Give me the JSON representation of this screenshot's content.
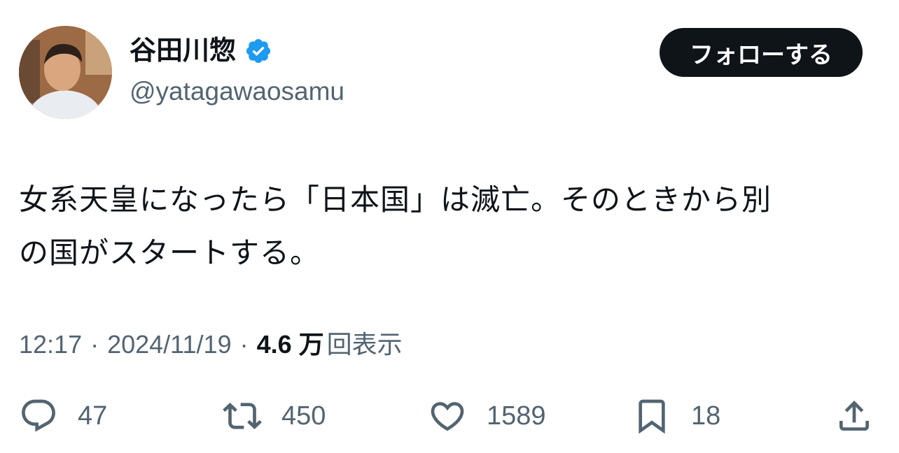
{
  "author": {
    "display_name": "谷田川惣",
    "handle": "@yatagawaosamu",
    "verified": true,
    "verified_color": "#1d9bf0"
  },
  "follow_button": {
    "label": "フォローする"
  },
  "tweet": {
    "line1": "女系天皇になったら「日本国」は滅亡。そのときから別",
    "line2": "の国がスタートする。"
  },
  "meta": {
    "time": "12:17",
    "separator": "·",
    "date": "2024/11/19",
    "views_count": "4.6 万",
    "views_label": "回表示"
  },
  "actions": {
    "replies": "47",
    "reposts": "450",
    "likes": "1589",
    "bookmarks": "18"
  },
  "icons": [
    "verified-icon",
    "reply-icon",
    "repost-icon",
    "like-icon",
    "bookmark-icon",
    "share-icon"
  ]
}
